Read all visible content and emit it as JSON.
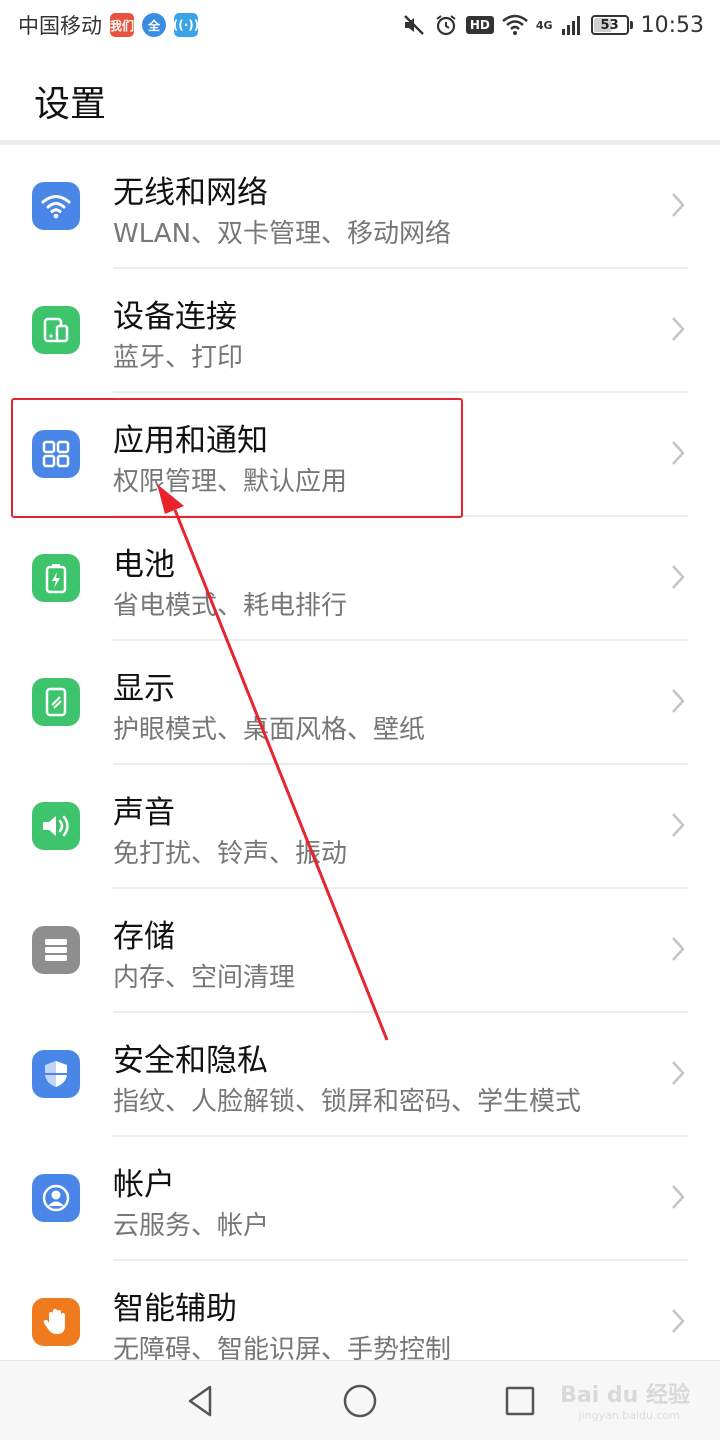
{
  "status_bar": {
    "carrier": "中国移动",
    "badge_1": "我们",
    "badge_2": "全",
    "badge_3": "((·))",
    "hd": "HD",
    "network": "4G",
    "battery": "53",
    "battery_level_percent": 53,
    "time": "10:53",
    "icons": [
      "mute-icon",
      "alarm-icon",
      "wifi-icon",
      "signal-icon",
      "battery-icon"
    ]
  },
  "header": {
    "title": "设置"
  },
  "settings": [
    {
      "title": "无线和网络",
      "subtitle": "WLAN、双卡管理、移动网络",
      "icon": "wifi-icon",
      "color": "#4a86e8"
    },
    {
      "title": "设备连接",
      "subtitle": "蓝牙、打印",
      "icon": "device-connect-icon",
      "color": "#3ec46d"
    },
    {
      "title": "应用和通知",
      "subtitle": "权限管理、默认应用",
      "icon": "apps-grid-icon",
      "color": "#4a86e8"
    },
    {
      "title": "电池",
      "subtitle": "省电模式、耗电排行",
      "icon": "battery-icon",
      "color": "#3ec46d"
    },
    {
      "title": "显示",
      "subtitle": "护眼模式、桌面风格、壁纸",
      "icon": "display-icon",
      "color": "#3ec46d"
    },
    {
      "title": "声音",
      "subtitle": "免打扰、铃声、振动",
      "icon": "speaker-icon",
      "color": "#3ec46d"
    },
    {
      "title": "存储",
      "subtitle": "内存、空间清理",
      "icon": "storage-icon",
      "color": "#8e8e8e"
    },
    {
      "title": "安全和隐私",
      "subtitle": "指纹、人脸解锁、锁屏和密码、学生模式",
      "icon": "shield-icon",
      "color": "#4a86e8"
    },
    {
      "title": "帐户",
      "subtitle": "云服务、帐户",
      "icon": "account-icon",
      "color": "#4a86e8"
    },
    {
      "title": "智能辅助",
      "subtitle": "无障碍、智能识屏、手势控制",
      "icon": "hand-icon",
      "color": "#f07a1e"
    }
  ],
  "annotation": {
    "highlight_color": "#e8232b"
  },
  "nav": {
    "back": "back-icon",
    "home": "home-icon",
    "recent": "recent-icon"
  },
  "watermark": {
    "brand": "Bai du 经验",
    "url": "jingyan.baidu.com"
  }
}
